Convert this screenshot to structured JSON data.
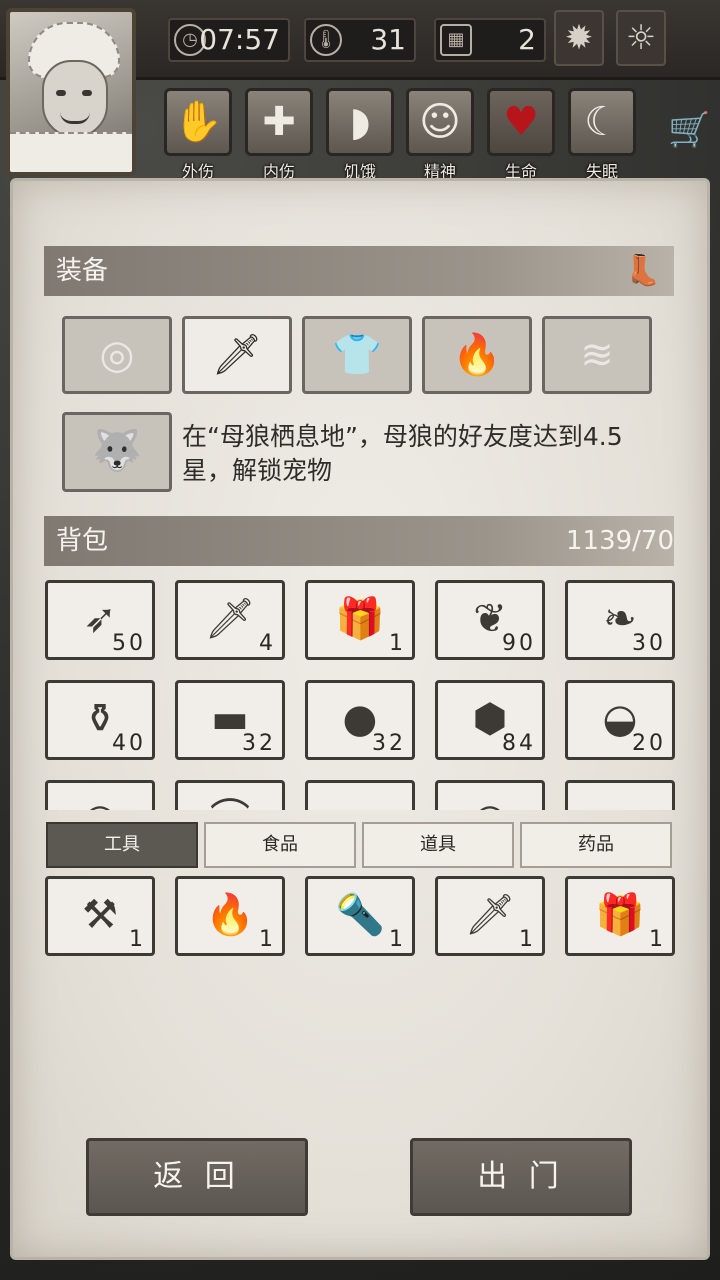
{
  "hud": {
    "time": "07:57",
    "temperature": "31",
    "day": "2",
    "time_icon": "clock-icon",
    "temp_icon": "thermometer-icon",
    "day_icon": "calendar-icon"
  },
  "status_icons": [
    {
      "label": "外伤",
      "icon": "hand-icon"
    },
    {
      "label": "内伤",
      "icon": "cross-icon"
    },
    {
      "label": "饥饿",
      "icon": "stomach-icon"
    },
    {
      "label": "精神",
      "icon": "head-icon"
    },
    {
      "label": "生命",
      "icon": "heart-icon"
    },
    {
      "label": "失眠",
      "icon": "moon-icon"
    }
  ],
  "equipment": {
    "title": "装备",
    "pet_hint": "在“母狼栖息地”，母狼的好友度达到4.5星，解锁宠物"
  },
  "backpack": {
    "title": "背包",
    "capacity": "1139/70",
    "items": [
      {
        "name": "arrows",
        "count": "50"
      },
      {
        "name": "knife",
        "count": "4"
      },
      {
        "name": "gift-box",
        "count": "1"
      },
      {
        "name": "herb-branch",
        "count": "90"
      },
      {
        "name": "ginseng-root",
        "count": "30"
      },
      {
        "name": "bottle-leaves",
        "count": "40"
      },
      {
        "name": "dark-cloth",
        "count": "32"
      },
      {
        "name": "iron-ball",
        "count": "32"
      },
      {
        "name": "honeycomb",
        "count": "84"
      },
      {
        "name": "nut-bowl",
        "count": "20"
      }
    ]
  },
  "tabs": [
    "工具",
    "食品",
    "道具",
    "药品"
  ],
  "tools": [
    {
      "name": "axe",
      "count": "1"
    },
    {
      "name": "torch",
      "count": "1"
    },
    {
      "name": "flashlight",
      "count": "1"
    },
    {
      "name": "knife",
      "count": "1"
    },
    {
      "name": "supply-box",
      "count": "1"
    }
  ],
  "buttons": {
    "back": "返 回",
    "go_out": "出 门"
  }
}
